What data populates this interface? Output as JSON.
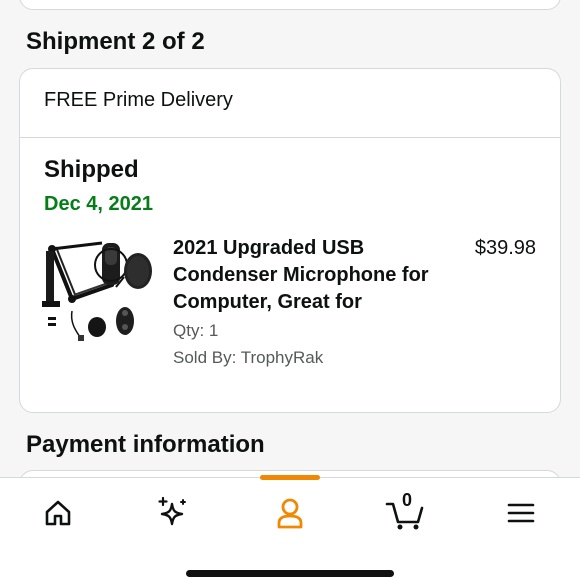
{
  "colors": {
    "accent": "#f08804",
    "delivered_green": "#067d18",
    "icon_dark": "#0f1111"
  },
  "shipment": {
    "heading": "Shipment 2 of 2",
    "delivery_option": "FREE Prime Delivery",
    "status": "Shipped",
    "date": "Dec 4, 2021",
    "item": {
      "image": "usb-condenser-microphone-kit-image",
      "title": "2021 Upgraded USB Condenser Microphone for Computer, Great for",
      "price": "$39.98",
      "qty": "Qty: 1",
      "sold_by": "Sold By: TrophyRak"
    }
  },
  "payment": {
    "heading": "Payment information"
  },
  "nav": {
    "items": [
      {
        "name": "home",
        "icon": "home-icon"
      },
      {
        "name": "ai-assistant",
        "icon": "sparkle-icon"
      },
      {
        "name": "account",
        "icon": "person-icon",
        "active": true
      },
      {
        "name": "cart",
        "icon": "cart-icon",
        "count": "0"
      },
      {
        "name": "menu",
        "icon": "hamburger-icon"
      }
    ]
  }
}
